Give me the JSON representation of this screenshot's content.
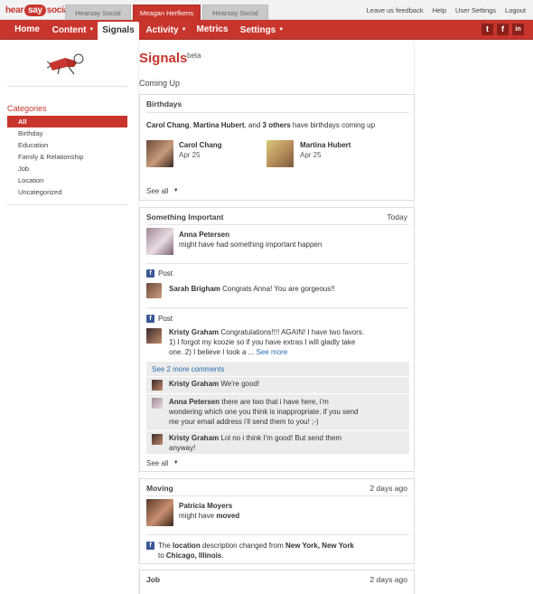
{
  "topbar": {
    "logo_part1": "hear",
    "logo_part2": "say",
    "logo_part3": "social",
    "accounts": [
      "Hearsay Social",
      "Meagan Herfkens",
      "Hearsay Social"
    ],
    "links": [
      "Leave us feedback",
      "Help",
      "User Settings",
      "Logout"
    ]
  },
  "nav": {
    "items": [
      "Home",
      "Content",
      "Signals",
      "Activity",
      "Metrics",
      "Settings"
    ],
    "social": [
      "t",
      "f",
      "in"
    ]
  },
  "sidebar": {
    "categories_title": "Categories",
    "categories": [
      "All",
      "Birthday",
      "Education",
      "Family & Relationship",
      "Job",
      "Location",
      "Uncategorized"
    ]
  },
  "main": {
    "title": "Signals",
    "beta": "beta",
    "coming_up": "Coming Up"
  },
  "birthdays": {
    "heading": "Birthdays",
    "summary_name1": "Carol Chang",
    "summary_sep1": ",",
    "summary_name2": "Martina Hubert",
    "summary_and": ", and",
    "summary_others": "3 others",
    "summary_tail": "have birthdays coming up",
    "people": [
      {
        "name": "Carol Chang",
        "date": "Apr 25"
      },
      {
        "name": "Martina Hubert",
        "date": "Apr 25"
      }
    ],
    "see_all": "See all"
  },
  "important": {
    "heading": "Something Important",
    "date": "Today",
    "person": "Anna Petersen",
    "desc": "might have had something important happen",
    "post_label": "Post",
    "post1_author": "Sarah Brigham",
    "post1_text": "Congrats Anna! You are gorgeous!!",
    "post2_author": "Kristy Graham",
    "post2_line1": "Congratulations!!!! AGAIN! I have two favors.",
    "post2_line2": "1) I forgot my koozie so if you have extras I will gladly take",
    "post2_line3": "one. 2) I believe I took a ...",
    "see_more": "See more",
    "more_comments": "See 2 more comments",
    "c1_author": "Kristy Graham",
    "c1_text": "We're good!",
    "c2_author": "Anna Petersen",
    "c2_line1": "there are two that i have here, i'm",
    "c2_line2": "wondering which one you think is inappropriate. if you send",
    "c2_line3": "me your email address i'll send them to you! ;-)",
    "c3_author": "Kristy Graham",
    "c3_line1": "Lol no i think I'm good! But send them",
    "c3_line2": "anyway!",
    "see_all": "See all"
  },
  "moving": {
    "heading": "Moving",
    "date": "2 days ago",
    "person": "Patricia Moyers",
    "desc_prefix": "might have",
    "desc_bold": "moved",
    "change_pre": "The",
    "change_field": "location",
    "change_mid": "description changed from",
    "change_from": "New York, New York",
    "change_to_word": "to",
    "change_to": "Chicago, Illinois",
    "change_end": "."
  },
  "job": {
    "heading": "Job",
    "date": "2 days ago"
  },
  "colors": {
    "brand": "#c8352d",
    "link": "#2a6cb0",
    "facebook": "#3b5998"
  }
}
